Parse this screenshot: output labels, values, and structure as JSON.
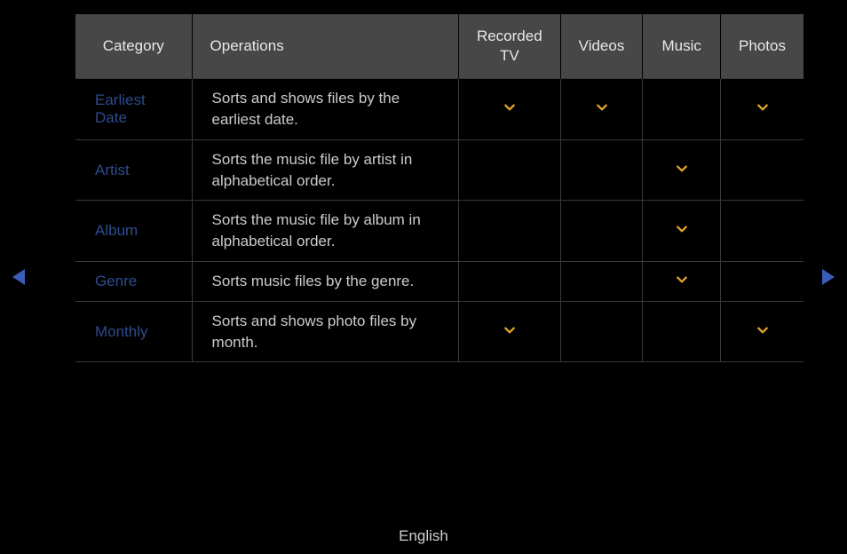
{
  "table": {
    "headers": {
      "category": "Category",
      "operations": "Operations",
      "recorded_tv": "Recorded TV",
      "videos": "Videos",
      "music": "Music",
      "photos": "Photos"
    },
    "rows": [
      {
        "category": "Earliest Date",
        "operations": "Sorts and shows files by the earliest date.",
        "recorded_tv": true,
        "videos": true,
        "music": false,
        "photos": true
      },
      {
        "category": "Artist",
        "operations": "Sorts the music file by artist in alphabetical order.",
        "recorded_tv": false,
        "videos": false,
        "music": true,
        "photos": false
      },
      {
        "category": "Album",
        "operations": "Sorts the music file by album in alphabetical order.",
        "recorded_tv": false,
        "videos": false,
        "music": true,
        "photos": false
      },
      {
        "category": "Genre",
        "operations": "Sorts music files by the genre.",
        "recorded_tv": false,
        "videos": false,
        "music": true,
        "photos": false
      },
      {
        "category": "Monthly",
        "operations": "Sorts and shows photo files by month.",
        "recorded_tv": true,
        "videos": false,
        "music": false,
        "photos": true
      }
    ]
  },
  "footer": {
    "language": "English"
  }
}
